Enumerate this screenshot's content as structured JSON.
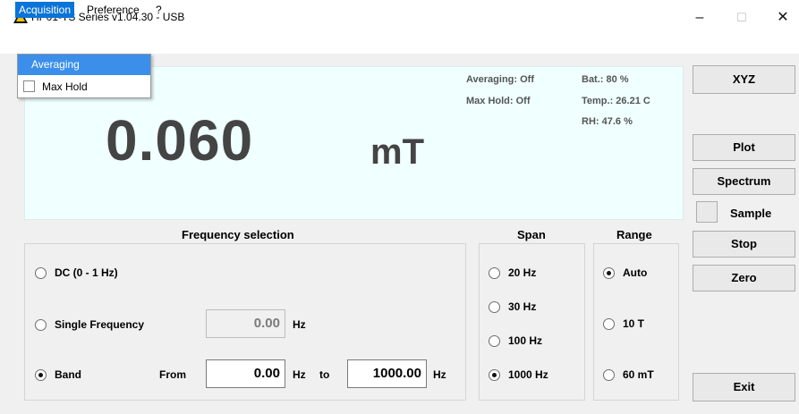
{
  "window": {
    "title": "HP01-TS Series v1.04.30 - USB",
    "controls": {
      "minimize": "–",
      "maximize": "☐",
      "close": "✕"
    }
  },
  "menu": {
    "items": [
      "Acquisition",
      "Preference",
      "?"
    ],
    "dropdown": {
      "averaging": "Averaging",
      "max_hold": "Max Hold",
      "max_hold_checked": false
    }
  },
  "display": {
    "reading": "0.060",
    "unit": "mT",
    "averaging": "Averaging: Off",
    "max_hold": "Max Hold: Off",
    "battery": "Bat.: 80 %",
    "temperature": "Temp.: 26.21 C",
    "humidity": "RH: 47.6 %"
  },
  "buttons": {
    "xyz": "XYZ",
    "plot": "Plot",
    "spectrum": "Spectrum",
    "sample": "Sample",
    "stop": "Stop",
    "zero": "Zero",
    "exit": "Exit"
  },
  "frequency": {
    "header": "Frequency selection",
    "dc": "DC (0 - 1 Hz)",
    "single": "Single Frequency",
    "single_value": "0.00",
    "band": "Band",
    "from_label": "From",
    "from_value": "0.00",
    "to_label": "to",
    "to_value": "1000.00",
    "hz": "Hz",
    "selected": "Band"
  },
  "span": {
    "header": "Span",
    "options": [
      "20 Hz",
      "30 Hz",
      "100 Hz",
      "1000 Hz"
    ],
    "selected": "1000 Hz"
  },
  "range": {
    "header": "Range",
    "options": [
      "Auto",
      "10 T",
      "60 mT"
    ],
    "selected": "Auto"
  },
  "colors": {
    "menu_highlight": "#0a74d8",
    "dropdown_highlight": "#3b8fea",
    "display_bg": "#f0ffff"
  }
}
